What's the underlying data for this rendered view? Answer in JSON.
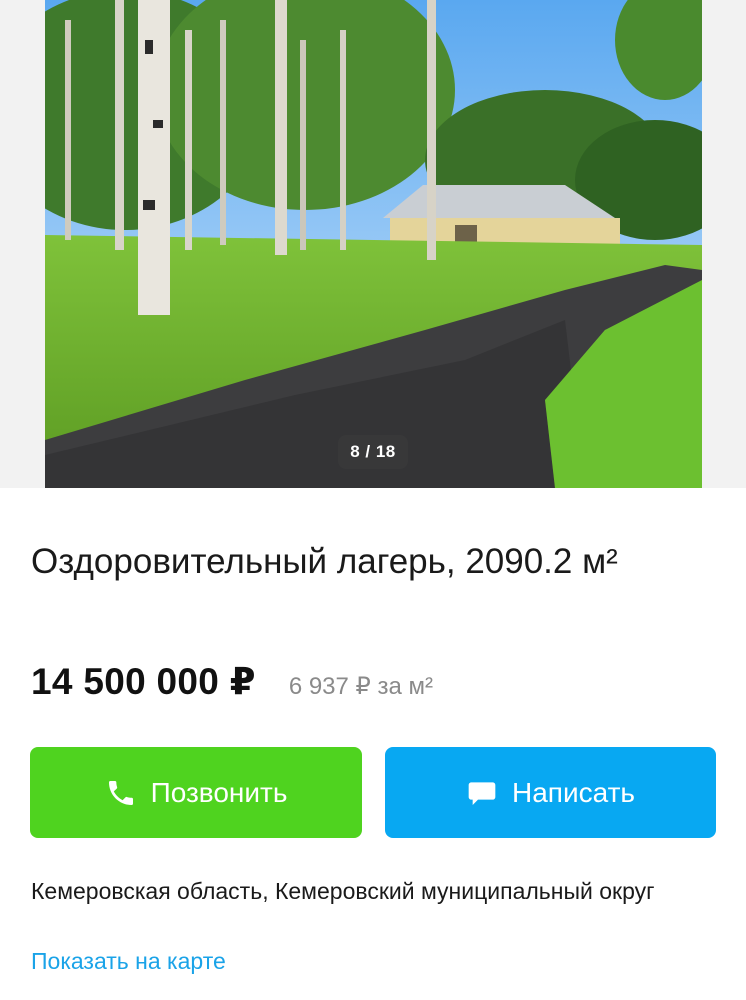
{
  "gallery": {
    "counter": "8 / 18"
  },
  "listing": {
    "title": "Оздоровительный лагерь, 2090.2 м²",
    "price": "14 500 000 ₽",
    "price_per_m2": "6 937 ₽ за м²"
  },
  "actions": {
    "call_label": "Позвонить",
    "write_label": "Написать",
    "call_color": "#4fd31f",
    "write_color": "#08a8f2"
  },
  "location": {
    "address": "Кемеровская область, Кемеровский муниципальный округ",
    "map_link": "Показать на карте"
  },
  "icons": {
    "call": "phone-icon",
    "write": "chat-bubble-icon"
  }
}
